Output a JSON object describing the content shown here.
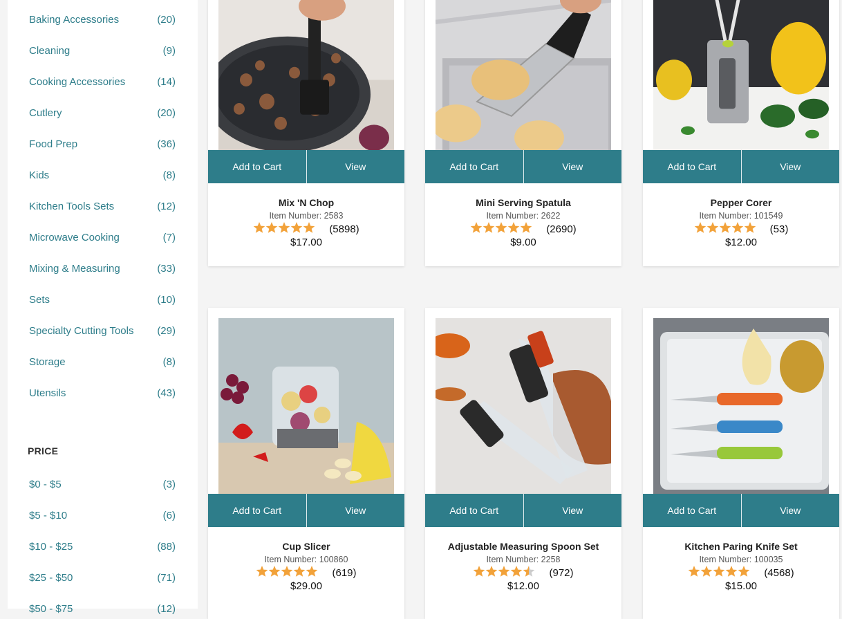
{
  "categories": [
    {
      "label": "Baking Accessories",
      "count": "(20)"
    },
    {
      "label": "Cleaning",
      "count": "(9)"
    },
    {
      "label": "Cooking Accessories",
      "count": "(14)"
    },
    {
      "label": "Cutlery",
      "count": "(20)"
    },
    {
      "label": "Food Prep",
      "count": "(36)"
    },
    {
      "label": "Kids",
      "count": "(8)"
    },
    {
      "label": "Kitchen Tools Sets",
      "count": "(12)"
    },
    {
      "label": "Microwave Cooking",
      "count": "(7)"
    },
    {
      "label": "Mixing & Measuring",
      "count": "(33)"
    },
    {
      "label": "Sets",
      "count": "(10)"
    },
    {
      "label": "Specialty Cutting Tools",
      "count": "(29)"
    },
    {
      "label": "Storage",
      "count": "(8)"
    },
    {
      "label": "Utensils",
      "count": "(43)"
    }
  ],
  "price_filter": {
    "title": "PRICE",
    "ranges": [
      {
        "label": "$0 - $5",
        "count": "(3)"
      },
      {
        "label": "$5 - $10",
        "count": "(6)"
      },
      {
        "label": "$10 - $25",
        "count": "(88)"
      },
      {
        "label": "$25 - $50",
        "count": "(71)"
      },
      {
        "label": "$50 - $75",
        "count": "(12)"
      }
    ]
  },
  "buttons": {
    "add_to_cart": "Add to Cart",
    "view": "View"
  },
  "colors": {
    "accent": "#2e7d8a",
    "star": "#f2a23a",
    "star_empty": "#cccccc"
  },
  "products": [
    {
      "name": "Mix 'N Chop",
      "item_number": "Item Number: 2583",
      "rating": 5,
      "reviews": "(5898)",
      "price": "$17.00",
      "image_icon": "skillet-chopper-image"
    },
    {
      "name": "Mini Serving Spatula",
      "item_number": "Item Number: 2622",
      "rating": 5,
      "reviews": "(2690)",
      "price": "$9.00",
      "image_icon": "spatula-cookies-image"
    },
    {
      "name": "Pepper Corer",
      "item_number": "Item Number: 101549",
      "rating": 5,
      "reviews": "(53)",
      "price": "$12.00",
      "image_icon": "pepper-corer-image"
    },
    {
      "name": "Cup Slicer",
      "item_number": "Item Number: 100860",
      "rating": 5,
      "reviews": "(619)",
      "price": "$29.00",
      "image_icon": "fruit-slicer-image"
    },
    {
      "name": "Adjustable Measuring Spoon Set",
      "item_number": "Item Number: 2258",
      "rating": 4.5,
      "reviews": "(972)",
      "price": "$12.00",
      "image_icon": "measuring-spoons-image"
    },
    {
      "name": "Kitchen Paring Knife Set",
      "item_number": "Item Number: 100035",
      "rating": 5,
      "reviews": "(4568)",
      "price": "$15.00",
      "image_icon": "paring-knives-image"
    }
  ]
}
